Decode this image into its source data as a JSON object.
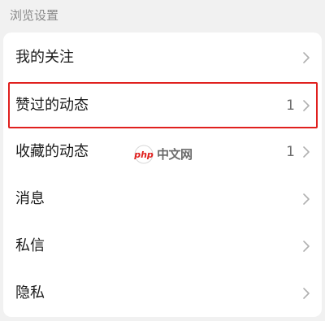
{
  "section": {
    "title": "浏览设置"
  },
  "rows": [
    {
      "label": "我的关注",
      "count": ""
    },
    {
      "label": "赞过的动态",
      "count": "1"
    },
    {
      "label": "收藏的动态",
      "count": "1"
    },
    {
      "label": "消息",
      "count": ""
    },
    {
      "label": "私信",
      "count": ""
    },
    {
      "label": "隐私",
      "count": ""
    }
  ],
  "watermark": {
    "text": "中文网",
    "logo_text": "php"
  },
  "colors": {
    "highlight_border": "#e0201e",
    "chevron": "#b0b0b0"
  }
}
